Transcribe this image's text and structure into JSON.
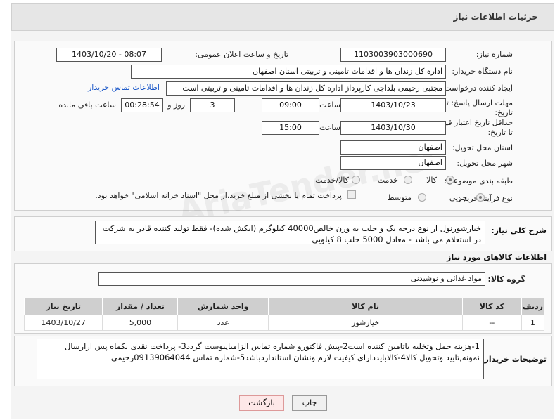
{
  "header": {
    "title": "جزئیات اطلاعات نیاز"
  },
  "form": {
    "need_number_label": "شماره نیاز:",
    "need_number": "1103003903000690",
    "announce_label": "تاریخ و ساعت اعلان عمومی:",
    "announce_value": "1403/10/20 - 08:07",
    "buyer_org_label": "نام دستگاه خریدار:",
    "buyer_org": "اداره کل زندان ها و اقدامات تامینی و تربیتی استان اصفهان",
    "creator_label": "ایجاد کننده درخواست:",
    "creator": "مجتبی رحیمی بلداجی کارپرداز اداره کل زندان ها و اقدامات تامینی و تربیتی است",
    "contact_link": "اطلاعات تماس خریدار",
    "reply_deadline_label": "مهلت ارسال پاسخ: تا تاریخ:",
    "reply_date": "1403/10/23",
    "time_label": "ساعت",
    "reply_time": "09:00",
    "days_value": "3",
    "days_label": "روز و",
    "remaining_time": "00:28:54",
    "remaining_label": "ساعت باقی مانده",
    "price_validity_label": "حداقل تاریخ اعتبار قیمت: تا تاریخ:",
    "price_date": "1403/10/30",
    "price_time": "15:00",
    "province_label": "استان محل تحویل:",
    "province": "اصفهان",
    "city_label": "شهر محل تحویل:",
    "city": "اصفهان",
    "category_label": "طبقه بندی موضوعی:",
    "category_options": [
      "کالا",
      "خدمت",
      "کالا/خدمت"
    ],
    "purchase_type_label": "نوع فرآیند خرید :",
    "purchase_options": [
      "جزیی",
      "متوسط"
    ],
    "payment_note": "پرداخت تمام یا بخشی از مبلغ خرید،از محل \"اسناد خزانه اسلامی\" خواهد بود."
  },
  "summary": {
    "label": "شرح کلی نیاز:",
    "text": "خیارشورنول از نوع درجه یک و جلب  به وزن خالص40000 کیلوگرم (ابکش شده)- فقط تولید کننده قادر به شرکت در استعلام می باشد - معادل 5000 حلب 8 کیلویی"
  },
  "goods": {
    "section_title": "اطلاعات کالاهای مورد نیاز",
    "group_label": "گروه کالا:",
    "group_value": "مواد غذائی و نوشیدنی",
    "columns": [
      "ردیف",
      "کد کالا",
      "نام کالا",
      "واحد شمارش",
      "تعداد / مقدار",
      "تاریخ نیاز"
    ],
    "rows": [
      [
        "1",
        "--",
        "خیارشور",
        "عدد",
        "5,000",
        "1403/10/27"
      ]
    ]
  },
  "buyer_notes": {
    "label": "توضیحات خریدار:",
    "text": "1-هزینه حمل وتخلیه باتامین کننده است2-پیش فاکتورو شماره تماس الزامیاپیوست گردد3- پرداخت نقدی یکماه  پس ازارسال نمونه,تایید وتحویل کالا4-کالابایددارای کیفیت لازم ونشان استانداردباشد5-شماره تماس 09139064044رحیمی"
  },
  "buttons": {
    "print": "چاپ",
    "back": "بازگشت"
  },
  "colors": {
    "link": "#1a57c8",
    "header_bg": "#e6e6e6",
    "table_head": "#cfcfcf"
  }
}
